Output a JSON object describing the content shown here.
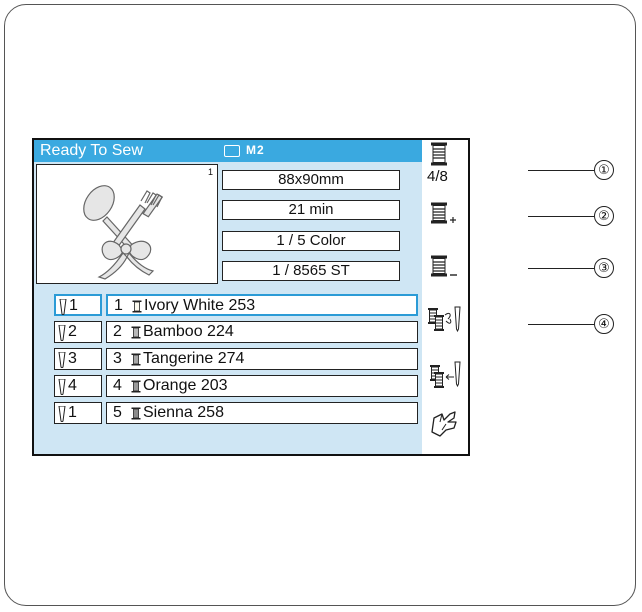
{
  "header": {
    "title": "Ready To Sew",
    "memory_label": "M2"
  },
  "design": {
    "preview_icon": "spoon-fork-bow-design",
    "index": "1"
  },
  "info": {
    "size": "88x90mm",
    "time": "21 min",
    "color": "1 / 5 Color",
    "stitches": "1 / 8565 ST"
  },
  "needle_rows": [
    {
      "needle": "1",
      "index": "1",
      "name": "Ivory White 253",
      "active": true
    },
    {
      "needle": "2",
      "index": "2",
      "name": "Bamboo 224",
      "active": false
    },
    {
      "needle": "3",
      "index": "3",
      "name": "Tangerine 274",
      "active": false
    },
    {
      "needle": "4",
      "index": "4",
      "name": "Orange 203",
      "active": false
    },
    {
      "needle": "1",
      "index": "5",
      "name": "Sienna 258",
      "active": false
    }
  ],
  "side_icons": {
    "spool_count": "4/8",
    "icons": [
      "spool-icon",
      "spool-plus-icon",
      "spool-minus-icon",
      "spool-swap-icon",
      "spool-assign-icon",
      "hand-pointer-icon"
    ]
  },
  "callouts": [
    "①",
    "②",
    "③",
    "④"
  ],
  "colors": {
    "accent": "#3aa9e0",
    "panel": "#cfe6f4",
    "active_border": "#2b9bd6"
  }
}
